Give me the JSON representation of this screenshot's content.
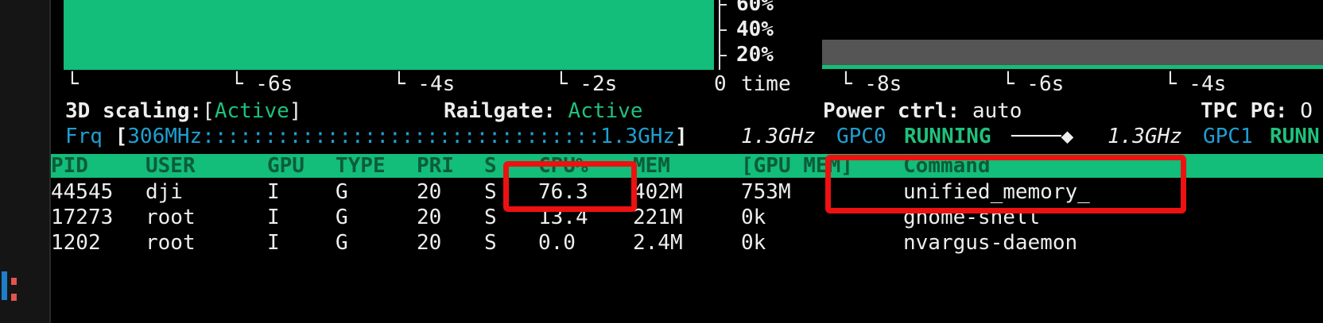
{
  "gpu_graph": {
    "y_ticks": [
      "60%",
      "40%",
      "20%"
    ],
    "time_ticks": [
      "└",
      "└ -6s",
      "└ -4s",
      "└ -2s",
      "0",
      "time"
    ]
  },
  "mem_graph": {
    "time_ticks": [
      "└ -8s",
      "└ -6s",
      "└ -4s"
    ]
  },
  "status": {
    "scaling_label": "3D scaling:",
    "scaling_open": "[",
    "scaling_value": "Active",
    "scaling_close": "]",
    "railgate_label": "Railgate:",
    "railgate_value": "Active",
    "power_ctrl_label": "Power ctrl:",
    "power_ctrl_value": "auto",
    "tpc_pg_label": "TPC PG:",
    "tpc_pg_value": "O"
  },
  "frequency": {
    "label": "Frq",
    "bracket_open": "[",
    "min": "306MHz",
    "bar_dots": "::::::::::::::::::::::::::::::::",
    "max": "1.3GHz",
    "bracket_close": "]",
    "current": "1.3GHz",
    "gpc0_label": "GPC0",
    "gpc0_state": "RUNNING",
    "gpc0_slider": "────◆",
    "gpc1_freq": "1.3GHz",
    "gpc1_label": "GPC1",
    "gpc1_state": "RUNN"
  },
  "process_table": {
    "headers": [
      "PID",
      "USER",
      "GPU",
      "TYPE",
      "PRI",
      "S",
      "CPU%",
      "MEM",
      "[GPU MEM]",
      "Command"
    ],
    "rows": [
      [
        "44545",
        "dji",
        "I",
        "G",
        "20",
        "S",
        "76.3",
        "402M",
        "753M",
        "unified_memory_"
      ],
      [
        "17273",
        "root",
        "I",
        "G",
        "20",
        "S",
        "13.4",
        "221M",
        "0k",
        "gnome-shell"
      ],
      [
        "1202",
        "root",
        "I",
        "G",
        "20",
        "S",
        "0.0",
        "2.4M",
        "0k",
        "nvargus-daemon"
      ]
    ]
  },
  "colors": {
    "accent_green": "#13bd7a",
    "label_blue": "#1e9fd1",
    "highlight_red": "#ee1111",
    "mem_graph_gray": "#555555"
  }
}
